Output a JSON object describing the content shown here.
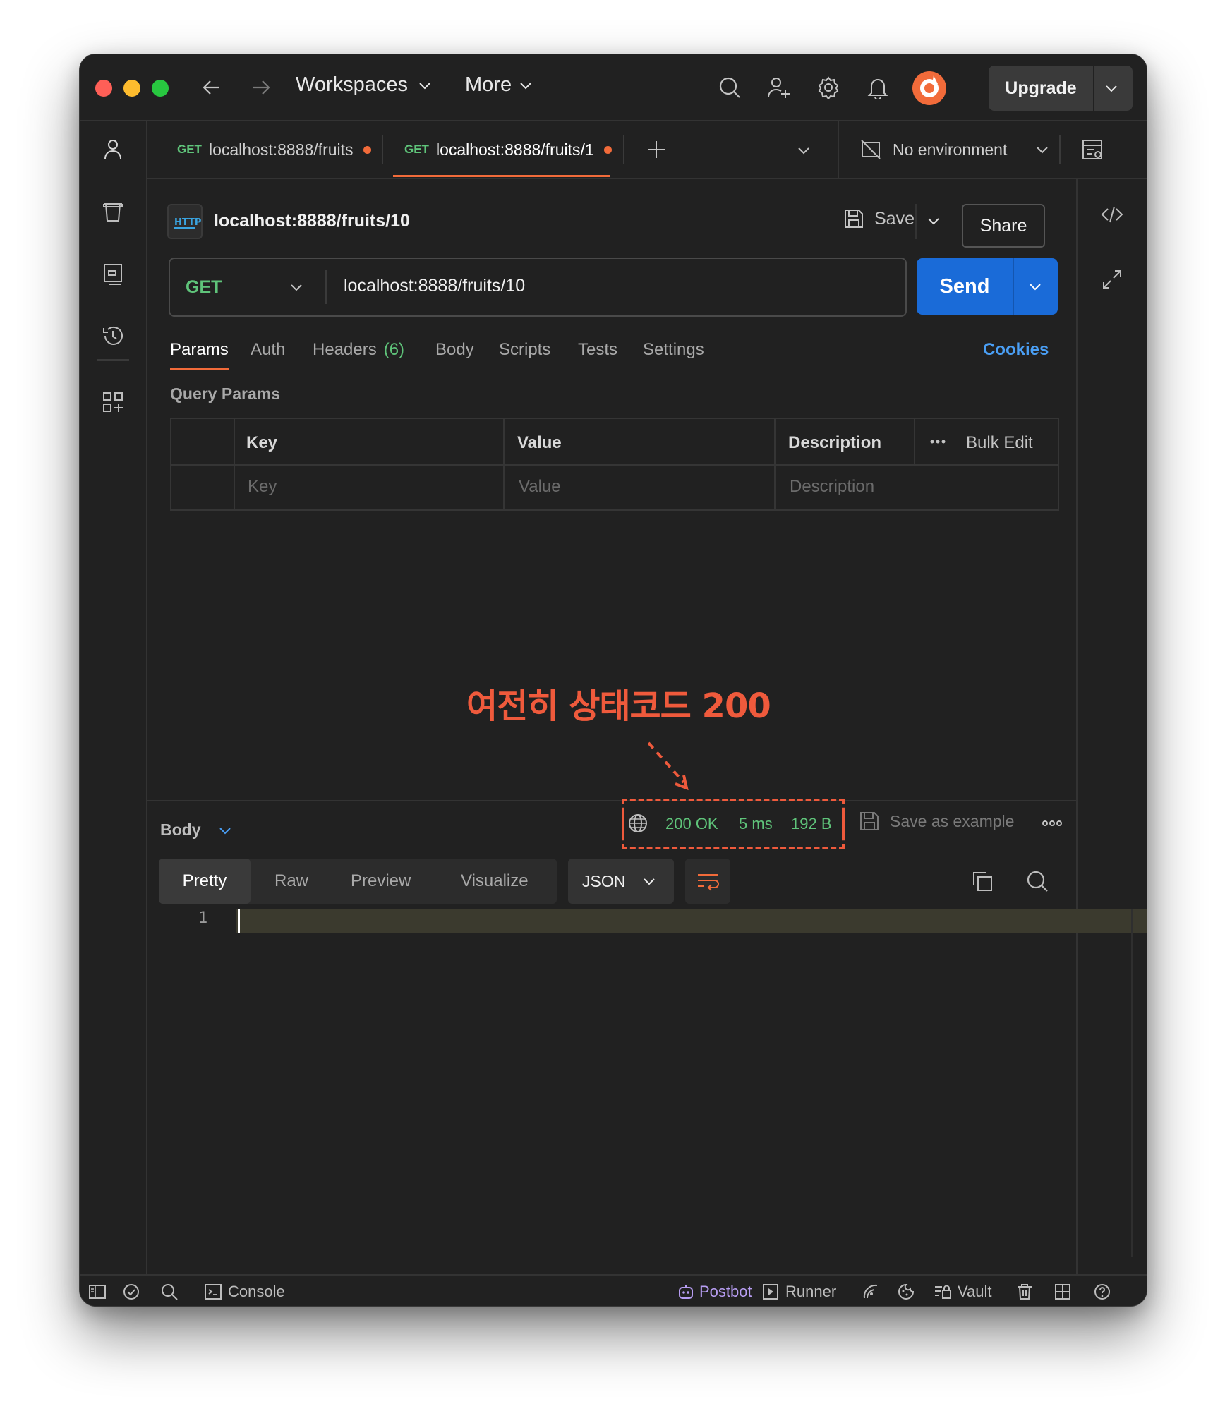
{
  "titlebar": {
    "workspaces": "Workspaces",
    "more": "More",
    "upgrade": "Upgrade"
  },
  "tabs": [
    {
      "method": "GET",
      "url": "localhost:8888/fruits",
      "unsaved": true
    },
    {
      "method": "GET",
      "url": "localhost:8888/fruits/1",
      "unsaved": true,
      "active": true
    }
  ],
  "environment": "No environment",
  "request": {
    "name": "localhost:8888/fruits/10",
    "save": "Save",
    "share": "Share",
    "method": "GET",
    "url": "localhost:8888/fruits/10",
    "send": "Send"
  },
  "subtabs": {
    "params": "Params",
    "auth": "Auth",
    "headers": "Headers",
    "headers_count": "(6)",
    "body": "Body",
    "scripts": "Scripts",
    "tests": "Tests",
    "settings": "Settings",
    "cookies": "Cookies"
  },
  "query_params": {
    "title": "Query Params",
    "columns": {
      "key": "Key",
      "value": "Value",
      "description": "Description"
    },
    "bulk_edit": "Bulk Edit",
    "placeholders": {
      "key": "Key",
      "value": "Value",
      "description": "Description"
    }
  },
  "annotation": "여전히 상태코드 200",
  "response": {
    "body_label": "Body",
    "status": "200 OK",
    "time": "5 ms",
    "size": "192 B",
    "save_example": "Save as example",
    "views": [
      "Pretty",
      "Raw",
      "Preview",
      "Visualize"
    ],
    "format": "JSON",
    "line_number": "1"
  },
  "statusbar": {
    "console": "Console",
    "postbot": "Postbot",
    "runner": "Runner",
    "vault": "Vault"
  },
  "colors": {
    "accent_send": "#1a6bd8",
    "method_get": "#5fc47a",
    "annotation": "#ef5a3c",
    "cookies_link": "#4a9ff5",
    "postbot": "#b79df2"
  }
}
